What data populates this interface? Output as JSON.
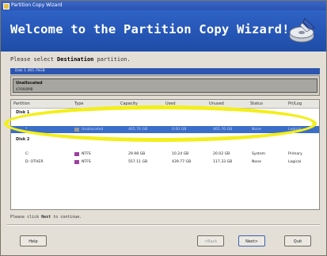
{
  "window": {
    "title": "Partition Copy Wizard"
  },
  "banner": {
    "title": "Welcome to the Partition Copy Wizard!",
    "icon": "wizard-disk-icon"
  },
  "prompt": {
    "prefix": "Please select ",
    "bold": "Destination",
    "suffix": " partition."
  },
  "disk1": {
    "label": "Disk 1   465.76GB"
  },
  "unallocated": {
    "name": "Unallocated",
    "size": "476940MB"
  },
  "table": {
    "headers": [
      "Partition",
      "Type",
      "Capacity",
      "Used",
      "Unused",
      "Status",
      "Pri/Log"
    ],
    "group1": "Disk 1",
    "rows_disk1": [
      {
        "partition": "*",
        "type": "Unallocated",
        "capacity": "465.76 GB",
        "used": "0.00 GB",
        "unused": "465.76 GB",
        "status": "None",
        "prilog": "Logical",
        "color": "#9a9a9a"
      }
    ],
    "group2": "Disk 2",
    "rows_disk2": [
      {
        "partition": "C:",
        "type": "NTFS",
        "capacity": "29.98 GB",
        "used": "10.24 GB",
        "unused": "20.02 GB",
        "status": "System",
        "prilog": "Primary",
        "color": "#9b3f9e"
      },
      {
        "partition": "D: OTHER",
        "type": "NTFS",
        "capacity": "557.11 GB",
        "used": "439.77 GB",
        "unused": "117.33 GB",
        "status": "None",
        "prilog": "Logical",
        "color": "#9b3f9e"
      }
    ]
  },
  "footer": {
    "prefix": "Please click ",
    "bold": "Next",
    "suffix": " to continue."
  },
  "buttons": {
    "help": "Help",
    "back": "<Back",
    "next": "Next>",
    "quit": "Quit"
  }
}
